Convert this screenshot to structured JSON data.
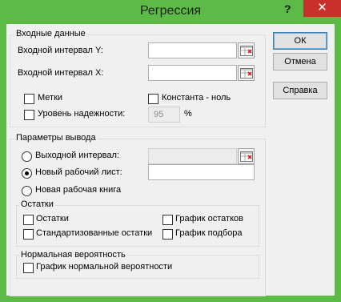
{
  "window": {
    "title": "Регрессия",
    "help_glyph": "?",
    "close_glyph": "✕"
  },
  "input": {
    "legend": "Входные данные",
    "y_range_label": "Входной интервал Y:",
    "y_range_value": "",
    "x_range_label": "Входной интервал X:",
    "x_range_value": "",
    "labels_label": "Метки",
    "constant_zero_label": "Константа - ноль",
    "confidence_label": "Уровень надежности:",
    "confidence_value": "95",
    "percent": "%"
  },
  "output": {
    "legend": "Параметры вывода",
    "output_range_label": "Выходной интервал:",
    "output_range_value": "",
    "new_sheet_label": "Новый рабочий лист:",
    "new_sheet_value": "",
    "new_workbook_label": "Новая рабочая книга",
    "selected": "new_sheet"
  },
  "residuals": {
    "legend": "Остатки",
    "residuals_label": "Остатки",
    "standardized_label": "Стандартизованные остатки",
    "residual_plot_label": "График остатков",
    "line_fit_label": "График подбора"
  },
  "normal": {
    "legend": "Нормальная вероятность",
    "probability_plot_label": "График нормальной вероятности"
  },
  "buttons": {
    "ok": "ОК",
    "cancel": "Отмена",
    "help": "Справка"
  },
  "icons": {
    "range_selector": "range-collapse-icon"
  },
  "colors": {
    "frame": "#5cba47",
    "close": "#c7302b",
    "client": "#f0f0f0"
  }
}
